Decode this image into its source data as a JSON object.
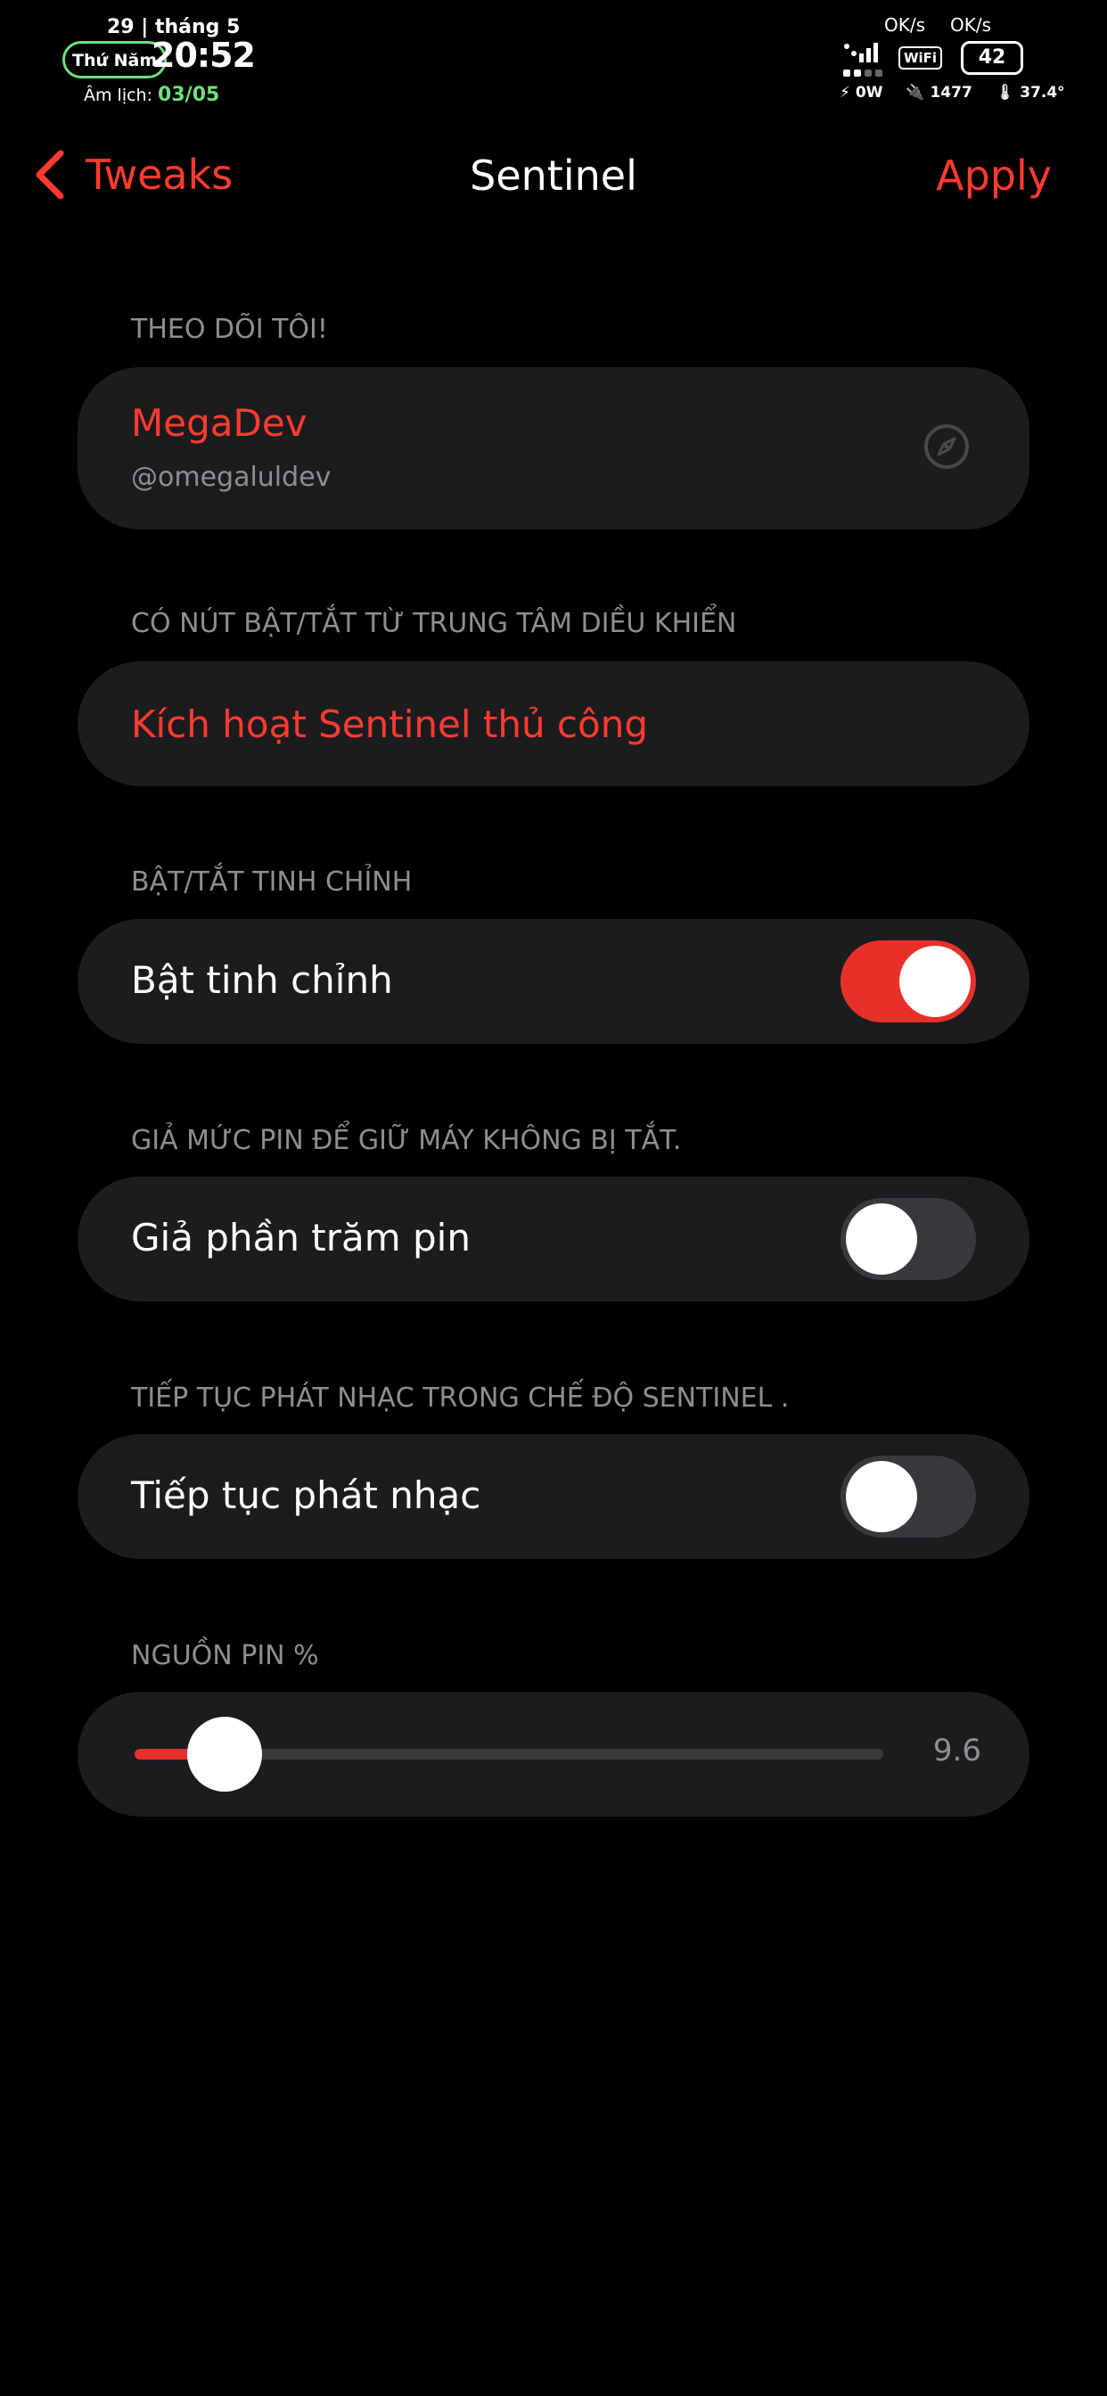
{
  "status_bar": {
    "date": "29 | tháng 5",
    "weekday": "Thứ Năm",
    "time": "20:52",
    "lunar_label": "Âm lịch:",
    "lunar_date": "03/05",
    "upload_speed": "OK/s",
    "download_speed": "OK/s",
    "wifi_label": "WiFi",
    "battery_level": "42",
    "power": "0W",
    "battery_cycles": "1477",
    "temperature": "37.4°"
  },
  "nav": {
    "back_label": "Tweaks",
    "title": "Sentinel",
    "apply_label": "Apply"
  },
  "sections": {
    "follow": {
      "header": "THEO DÕI TÔI!",
      "name": "MegaDev",
      "handle": "@omegaluldev"
    },
    "control_center": {
      "header": "CÓ NÚT BẬT/TẮT TỪ TRUNG TÂM DIỀU KHIỂN",
      "action_label": "Kích hoạt Sentinel thủ công"
    },
    "enable": {
      "header": "BẬT/TẮT TINH CHỈNH",
      "label": "Bật tinh chỉnh",
      "on": true
    },
    "fake_battery": {
      "header": "GIẢ MỨC PIN ĐỂ GIỮ MÁY KHÔNG BỊ TẮT.",
      "label": "Giả phần trăm pin",
      "on": false
    },
    "music": {
      "header": "TIẾP TỤC PHÁT NHẠC TRONG CHẾ ĐỘ SENTINEL .",
      "label": "Tiếp tục phát nhạc",
      "on": false
    },
    "battery_source": {
      "header": "NGUỒN PIN %",
      "value": "9.6",
      "value_fraction": 0.12
    }
  },
  "colors": {
    "accent": "#ff3b30",
    "toggle_on": "#e8302a",
    "lunar_green": "#6ee07a",
    "cell_bg": "#1c1c1e",
    "secondary_text": "#8e8e93"
  },
  "icons": {
    "back": "chevron-left-icon",
    "follow": "compass-icon"
  }
}
